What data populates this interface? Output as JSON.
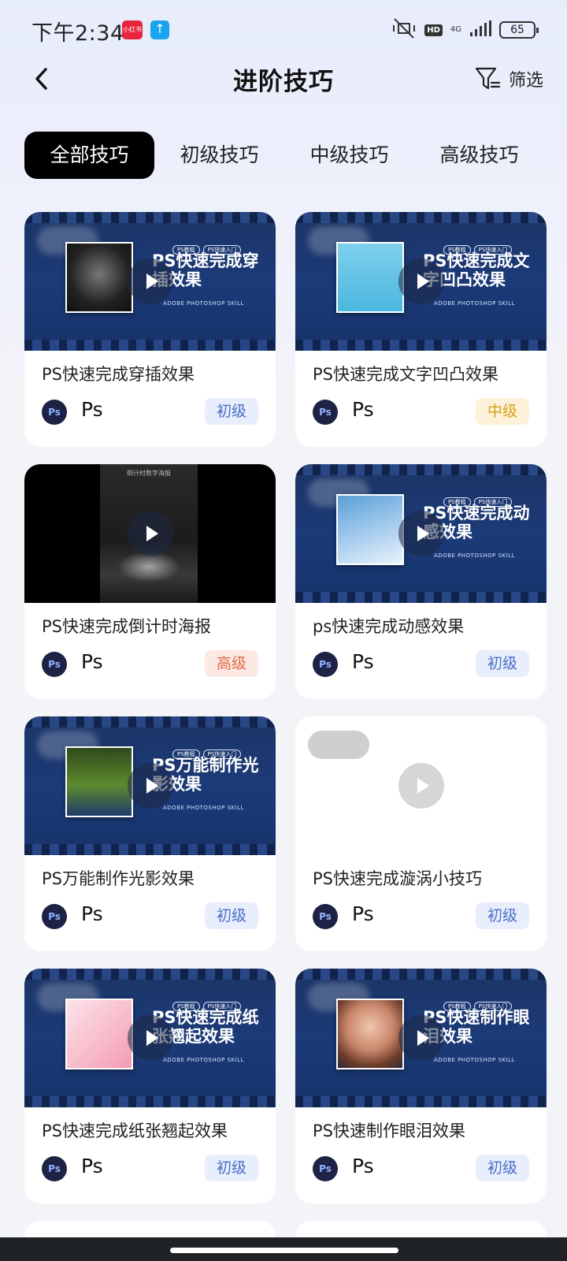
{
  "status_bar": {
    "time": "下午2:34",
    "app_badge_red": "小红书",
    "app_badge_blue": "↑",
    "hd": "HD",
    "network": "4G",
    "battery": "65"
  },
  "header": {
    "title": "进阶技巧",
    "filter_label": "筛选"
  },
  "tabs": [
    {
      "label": "全部技巧",
      "active": true
    },
    {
      "label": "初级技巧",
      "active": false
    },
    {
      "label": "中级技巧",
      "active": false
    },
    {
      "label": "高级技巧",
      "active": false
    }
  ],
  "cards": [
    {
      "title": "PS快速完成穿插效果",
      "app": "Ps",
      "app_icon": "Ps",
      "level": "初级",
      "thumb": {
        "heading": "PS快速完成穿插效果",
        "tags": [
          "PS教程",
          "PS快速入门"
        ],
        "sub": "ADOBE PHOTOSHOP SKILL"
      }
    },
    {
      "title": "PS快速完成文字凹凸效果",
      "app": "Ps",
      "app_icon": "Ps",
      "level": "中级",
      "thumb": {
        "heading": "PS快速完成文字凹凸效果",
        "tags": [
          "PS教程",
          "PS快速入门"
        ],
        "sub": "ADOBE PHOTOSHOP SKILL"
      }
    },
    {
      "title": "PS快速完成倒计时海报",
      "app": "Ps",
      "app_icon": "Ps",
      "level": "高级",
      "thumb": {
        "heading": "倒计时数字海报"
      }
    },
    {
      "title": "ps快速完成动感效果",
      "app": "Ps",
      "app_icon": "Ps",
      "level": "初级",
      "thumb": {
        "heading": "PS快速完成动感效果",
        "tags": [
          "PS教程",
          "PS快速入门"
        ],
        "sub": "ADOBE PHOTOSHOP SKILL"
      }
    },
    {
      "title": "PS万能制作光影效果",
      "app": "Ps",
      "app_icon": "Ps",
      "level": "初级",
      "thumb": {
        "heading": "PS万能制作光影效果",
        "tags": [
          "PS教程",
          "PS快速入门"
        ],
        "sub": "ADOBE PHOTOSHOP SKILL"
      }
    },
    {
      "title": "PS快速完成漩涡小技巧",
      "app": "Ps",
      "app_icon": "Ps",
      "level": "初级",
      "thumb": {}
    },
    {
      "title": "PS快速完成纸张翘起效果",
      "app": "Ps",
      "app_icon": "Ps",
      "level": "初级",
      "thumb": {
        "heading": "PS快速完成纸张翘起效果",
        "tags": [
          "PS教程",
          "PS快速入门"
        ],
        "sub": "ADOBE PHOTOSHOP SKILL"
      }
    },
    {
      "title": "PS快速制作眼泪效果",
      "app": "Ps",
      "app_icon": "Ps",
      "level": "初级",
      "thumb": {
        "heading": "PS快速制作眼泪效果",
        "tags": [
          "PS教程",
          "PS快速入门"
        ],
        "sub": "ADOBE PHOTOSHOP SKILL"
      }
    }
  ],
  "colors": {
    "level_basic": "#4a6fc7",
    "level_mid": "#d8a11c",
    "level_adv": "#e06a49",
    "thumb_bg": "#1b3a78"
  }
}
